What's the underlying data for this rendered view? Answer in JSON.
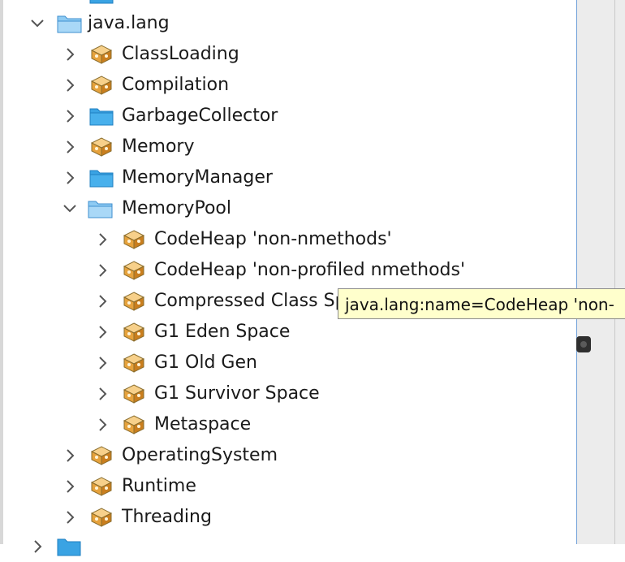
{
  "tree": {
    "java_lang": {
      "label": "java.lang",
      "expanded": true,
      "icon": "folder-open-icon"
    },
    "children": [
      {
        "label": "ClassLoading",
        "icon": "mbean-icon"
      },
      {
        "label": "Compilation",
        "icon": "mbean-icon"
      },
      {
        "label": "GarbageCollector",
        "icon": "folder-icon"
      },
      {
        "label": "Memory",
        "icon": "mbean-icon"
      },
      {
        "label": "MemoryManager",
        "icon": "folder-icon"
      },
      {
        "label": "MemoryPool",
        "icon": "folder-open-icon",
        "expanded": true
      },
      {
        "label": "OperatingSystem",
        "icon": "mbean-icon"
      },
      {
        "label": "Runtime",
        "icon": "mbean-icon"
      },
      {
        "label": "Threading",
        "icon": "mbean-icon"
      }
    ],
    "memory_pools": [
      {
        "label": "CodeHeap 'non-nmethods'"
      },
      {
        "label": "CodeHeap 'non-profiled nmethods'"
      },
      {
        "label": "Compressed Class Space"
      },
      {
        "label": "G1 Eden Space"
      },
      {
        "label": "G1 Old Gen"
      },
      {
        "label": "G1 Survivor Space"
      },
      {
        "label": "Metaspace"
      }
    ]
  },
  "tooltip": {
    "text": "java.lang:name=CodeHeap 'non-"
  },
  "colors": {
    "folder": "#3aa3e3",
    "tooltip_bg": "#ffffcc",
    "mbean": "#e6a23c"
  }
}
